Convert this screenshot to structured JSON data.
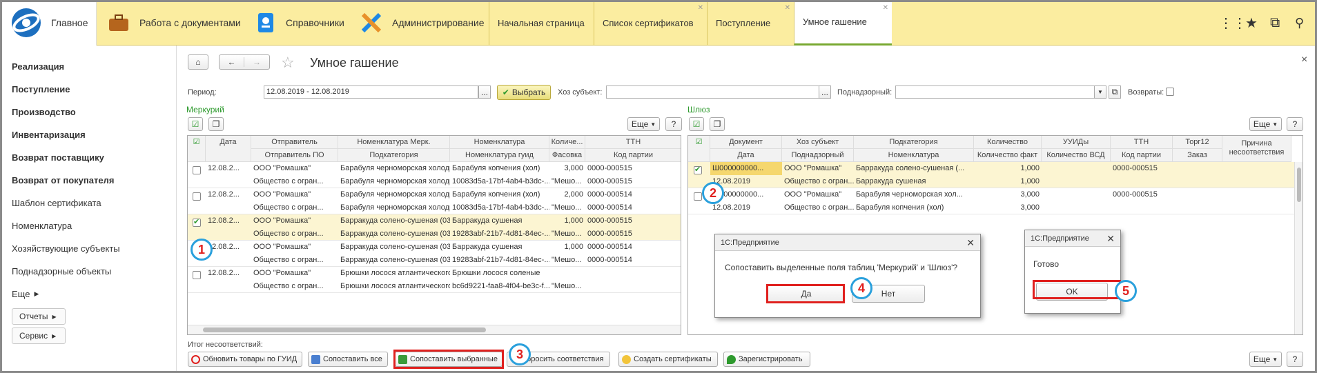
{
  "topbar": {
    "home": "Главное",
    "sections": [
      "Работа с документами",
      "Справочники",
      "Администрирование"
    ],
    "tabs": [
      {
        "label": "Начальная страница",
        "close": false
      },
      {
        "label": "Список сертификатов",
        "close": true
      },
      {
        "label": "Поступление",
        "close": true
      },
      {
        "label": "Умное гашение",
        "close": true
      }
    ]
  },
  "leftnav": {
    "items": [
      "Реализация",
      "Поступление",
      "Производство",
      "Инвентаризация",
      "Возврат поставщику",
      "Возврат от покупателя",
      "Шаблон сертификата",
      "Номенклатура",
      "Хозяйствующие субъекты",
      "Поднадзорные объекты",
      "Еще"
    ],
    "buttons": [
      "Отчеты",
      "Сервис"
    ]
  },
  "page": {
    "title": "Умное гашение",
    "close": "×"
  },
  "filters": {
    "period_label": "Период:",
    "period_value": "12.08.2019 - 12.08.2019",
    "choose": "Выбрать",
    "subject_label": "Хоз субъект:",
    "supervised_label": "Поднадзорный:",
    "returns_label": "Возвраты:"
  },
  "mercury": {
    "title": "Меркурий",
    "more": "Еще",
    "help": "?",
    "headers1": [
      "Дата",
      "Отправитель",
      "Номенклатура Мерк.",
      "Номенклатура",
      "Количе...",
      "ТТН"
    ],
    "headers2": [
      "Отправитель ПО",
      "Подкатегория",
      "Номенклатура гуид",
      "Фасовка",
      "Код партии"
    ],
    "rows": [
      {
        "checked": false,
        "date": "12.08.2...",
        "sender": "ООО \"Ромашка\"",
        "nom_merk": "Барабуля черноморская холодног...",
        "nom": "Барабуля копчения (хол)",
        "qty": "3,000",
        "ttn": "0000-000515",
        "sender_po": "Общество с огран...",
        "subcat": "Барабуля черноморская холодног...",
        "guid": "10083d5a-17bf-4ab4-b3dc-...",
        "pack": "\"Мешо...",
        "batch": "0000-000515"
      },
      {
        "checked": false,
        "date": "12.08.2...",
        "sender": "ООО \"Ромашка\"",
        "nom_merk": "Барабуля черноморская холодног...",
        "nom": "Барабуля копчения (хол)",
        "qty": "2,000",
        "ttn": "0000-000514",
        "sender_po": "Общество с огран...",
        "subcat": "Барабуля черноморская холодног...",
        "guid": "10083d5a-17bf-4ab4-b3dc-...",
        "pack": "\"Мешо...",
        "batch": "0000-000514"
      },
      {
        "checked": true,
        "date": "12.08.2...",
        "sender": "ООО \"Ромашка\"",
        "nom_merk": "Барракуда солено-сушеная (0305)",
        "nom": "Барракуда сушеная",
        "qty": "1,000",
        "ttn": "0000-000515",
        "sender_po": "Общество с огран...",
        "subcat": "Барракуда солено-сушеная (0305)",
        "guid": "19283abf-21b7-4d81-84ec-...",
        "pack": "\"Мешо...",
        "batch": "0000-000515"
      },
      {
        "checked": false,
        "date": "12.08.2...",
        "sender": "ООО \"Ромашка\"",
        "nom_merk": "Барракуда солено-сушеная (0305)",
        "nom": "Барракуда сушеная",
        "qty": "1,000",
        "ttn": "0000-000514",
        "sender_po": "Общество с огран...",
        "subcat": "Барракуда солено-сушеная (0305)",
        "guid": "19283abf-21b7-4d81-84ec-...",
        "pack": "\"Мешо...",
        "batch": "0000-000514"
      },
      {
        "checked": false,
        "date": "12.08.2...",
        "sender": "ООО \"Ромашка\"",
        "nom_merk": "Брюшки лосося атлантического с...",
        "nom": "Брюшки лосося соленые",
        "qty": "",
        "ttn": "",
        "sender_po": "Общество с огран...",
        "subcat": "Брюшки лосося атлантического с...",
        "guid": "bc6d9221-faa8-4f04-be3c-f...",
        "pack": "\"Мешо...",
        "batch": ""
      }
    ]
  },
  "gateway": {
    "title": "Шлюз",
    "more": "Еще",
    "help": "?",
    "headers1": [
      "Документ",
      "Хоз субъект",
      "Подкатегория",
      "Количество",
      "УУИДы",
      "ТТН",
      "Торг12",
      "Причина несоответствия"
    ],
    "headers2": [
      "Дата",
      "Поднадзорный",
      "Номенклатура",
      "Количество факт",
      "Количество ВСД",
      "Код партии",
      "Заказ"
    ],
    "rows": [
      {
        "checked": true,
        "doc": "Ш000000000...",
        "subject": "ООО \"Ромашка\"",
        "subcat": "Барракуда солено-сушеная (...",
        "qty": "1,000",
        "ttn": "0000-000515",
        "date": "12.08.2019",
        "supervised": "Общество с огран...",
        "nom": "Барракуда сушеная",
        "qty_fact": "1,000"
      },
      {
        "checked": false,
        "doc": "Ш000000000...",
        "subject": "ООО \"Ромашка\"",
        "subcat": "Барабуля черноморская хол...",
        "qty": "3,000",
        "ttn": "0000-000515",
        "date": "12.08.2019",
        "supervised": "Общество с огран...",
        "nom": "Барабуля копчения (хол)",
        "qty_fact": "3,000"
      }
    ]
  },
  "dialog1": {
    "title": "1С:Предприятие",
    "message": "Сопоставить выделенные поля таблиц 'Меркурий' и 'Шлюз'?",
    "yes": "Да",
    "no": "Нет"
  },
  "dialog2": {
    "title": "1С:Предприятие",
    "message": "Готово",
    "ok": "OK"
  },
  "footer": {
    "mismatch_label": "Итог несоответствий:",
    "buttons": [
      "Обновить товары по ГУИД",
      "Сопоставить все",
      "Сопоставить выбранные",
      "Сбросить соответствия",
      "Создать сертификаты",
      "Зарегистрировать"
    ],
    "more": "Еще",
    "help": "?"
  },
  "markers": [
    "1",
    "2",
    "3",
    "4",
    "5"
  ],
  "colors": {
    "topbar": "#fbeda0",
    "selected_row": "#fcf5d2",
    "accent_green": "#2e9a2e",
    "marker_red": "#e0201e",
    "marker_blue": "#2aa0dc"
  }
}
